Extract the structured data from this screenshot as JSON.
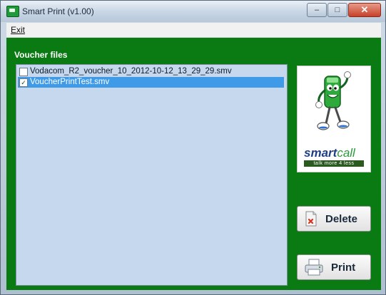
{
  "window": {
    "title": "Smart Print (v1.00)",
    "controls": {
      "minimize": "–",
      "maximize": "□",
      "close": "✕"
    }
  },
  "menu": {
    "exit_label": "Exit"
  },
  "voucher_files": {
    "label": "Voucher files",
    "items": [
      {
        "name": "Vodacom_R2_voucher_10_2012-10-12_13_29_29.smv",
        "checked": false,
        "selected": false
      },
      {
        "name": "VoucherPrintTest.smv",
        "checked": true,
        "selected": true
      }
    ]
  },
  "logo": {
    "brand_main": "smart",
    "brand_accent": "call",
    "tagline": "talk more 4 less"
  },
  "actions": {
    "delete_label": "Delete",
    "print_label": "Print"
  },
  "colors": {
    "client_bg": "#0a7a12",
    "list_bg": "#c6d8ed",
    "selection": "#3f9be8"
  }
}
